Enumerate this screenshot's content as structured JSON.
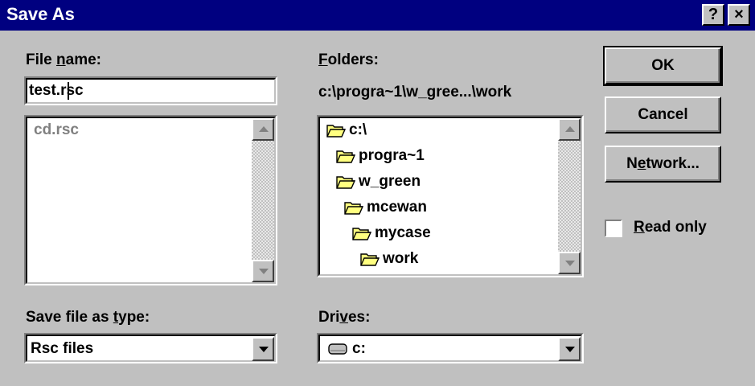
{
  "window": {
    "title": "Save As",
    "help_glyph": "?",
    "close_glyph": "×"
  },
  "file_name": {
    "label_pre": "File ",
    "label_accel": "n",
    "label_post": "ame:",
    "value": "test.rsc",
    "files": [
      "cd.rsc"
    ]
  },
  "folders": {
    "label_accel": "F",
    "label_post": "olders:",
    "current_path": "c:\\progra~1\\w_gree...\\work",
    "tree": [
      "c:\\",
      "progra~1",
      "w_green",
      "mcewan",
      "mycase",
      "work"
    ]
  },
  "buttons": {
    "ok": "OK",
    "cancel": "Cancel",
    "network_pre": "N",
    "network_accel": "e",
    "network_post": "twork..."
  },
  "read_only": {
    "accel": "R",
    "rest": "ead only",
    "checked": false
  },
  "save_type": {
    "label_pre": "Save file as ",
    "label_accel": "t",
    "label_post": "ype:",
    "value": "Rsc files"
  },
  "drives": {
    "label_pre": "Dri",
    "label_accel": "v",
    "label_post": "es:",
    "value": "c:"
  },
  "colors": {
    "titlebar": "#000080",
    "face": "#c0c0c0",
    "folder": "#ffff80"
  }
}
